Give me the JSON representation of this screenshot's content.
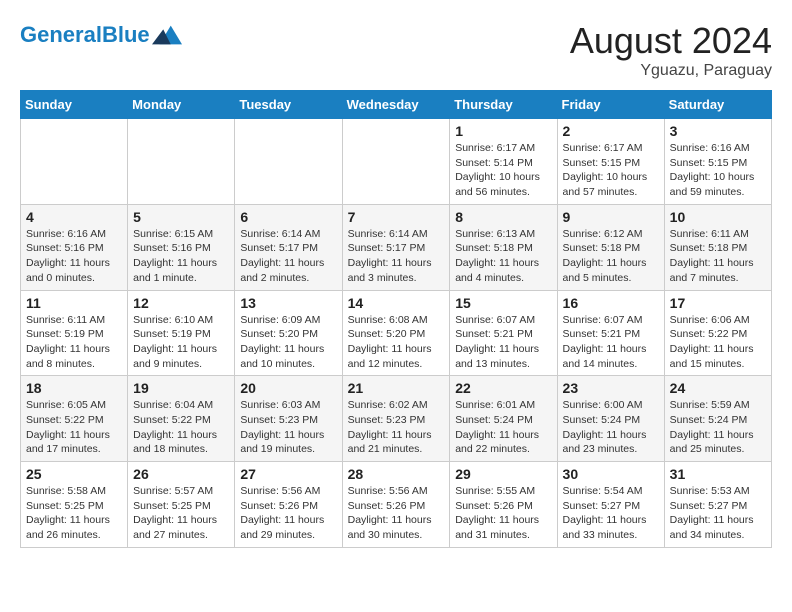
{
  "header": {
    "logo_line1": "General",
    "logo_line2": "Blue",
    "month": "August 2024",
    "location": "Yguazu, Paraguay"
  },
  "days_of_week": [
    "Sunday",
    "Monday",
    "Tuesday",
    "Wednesday",
    "Thursday",
    "Friday",
    "Saturday"
  ],
  "weeks": [
    [
      {
        "num": "",
        "info": ""
      },
      {
        "num": "",
        "info": ""
      },
      {
        "num": "",
        "info": ""
      },
      {
        "num": "",
        "info": ""
      },
      {
        "num": "1",
        "info": "Sunrise: 6:17 AM\nSunset: 5:14 PM\nDaylight: 10 hours and 56 minutes."
      },
      {
        "num": "2",
        "info": "Sunrise: 6:17 AM\nSunset: 5:15 PM\nDaylight: 10 hours and 57 minutes."
      },
      {
        "num": "3",
        "info": "Sunrise: 6:16 AM\nSunset: 5:15 PM\nDaylight: 10 hours and 59 minutes."
      }
    ],
    [
      {
        "num": "4",
        "info": "Sunrise: 6:16 AM\nSunset: 5:16 PM\nDaylight: 11 hours and 0 minutes."
      },
      {
        "num": "5",
        "info": "Sunrise: 6:15 AM\nSunset: 5:16 PM\nDaylight: 11 hours and 1 minute."
      },
      {
        "num": "6",
        "info": "Sunrise: 6:14 AM\nSunset: 5:17 PM\nDaylight: 11 hours and 2 minutes."
      },
      {
        "num": "7",
        "info": "Sunrise: 6:14 AM\nSunset: 5:17 PM\nDaylight: 11 hours and 3 minutes."
      },
      {
        "num": "8",
        "info": "Sunrise: 6:13 AM\nSunset: 5:18 PM\nDaylight: 11 hours and 4 minutes."
      },
      {
        "num": "9",
        "info": "Sunrise: 6:12 AM\nSunset: 5:18 PM\nDaylight: 11 hours and 5 minutes."
      },
      {
        "num": "10",
        "info": "Sunrise: 6:11 AM\nSunset: 5:18 PM\nDaylight: 11 hours and 7 minutes."
      }
    ],
    [
      {
        "num": "11",
        "info": "Sunrise: 6:11 AM\nSunset: 5:19 PM\nDaylight: 11 hours and 8 minutes."
      },
      {
        "num": "12",
        "info": "Sunrise: 6:10 AM\nSunset: 5:19 PM\nDaylight: 11 hours and 9 minutes."
      },
      {
        "num": "13",
        "info": "Sunrise: 6:09 AM\nSunset: 5:20 PM\nDaylight: 11 hours and 10 minutes."
      },
      {
        "num": "14",
        "info": "Sunrise: 6:08 AM\nSunset: 5:20 PM\nDaylight: 11 hours and 12 minutes."
      },
      {
        "num": "15",
        "info": "Sunrise: 6:07 AM\nSunset: 5:21 PM\nDaylight: 11 hours and 13 minutes."
      },
      {
        "num": "16",
        "info": "Sunrise: 6:07 AM\nSunset: 5:21 PM\nDaylight: 11 hours and 14 minutes."
      },
      {
        "num": "17",
        "info": "Sunrise: 6:06 AM\nSunset: 5:22 PM\nDaylight: 11 hours and 15 minutes."
      }
    ],
    [
      {
        "num": "18",
        "info": "Sunrise: 6:05 AM\nSunset: 5:22 PM\nDaylight: 11 hours and 17 minutes."
      },
      {
        "num": "19",
        "info": "Sunrise: 6:04 AM\nSunset: 5:22 PM\nDaylight: 11 hours and 18 minutes."
      },
      {
        "num": "20",
        "info": "Sunrise: 6:03 AM\nSunset: 5:23 PM\nDaylight: 11 hours and 19 minutes."
      },
      {
        "num": "21",
        "info": "Sunrise: 6:02 AM\nSunset: 5:23 PM\nDaylight: 11 hours and 21 minutes."
      },
      {
        "num": "22",
        "info": "Sunrise: 6:01 AM\nSunset: 5:24 PM\nDaylight: 11 hours and 22 minutes."
      },
      {
        "num": "23",
        "info": "Sunrise: 6:00 AM\nSunset: 5:24 PM\nDaylight: 11 hours and 23 minutes."
      },
      {
        "num": "24",
        "info": "Sunrise: 5:59 AM\nSunset: 5:24 PM\nDaylight: 11 hours and 25 minutes."
      }
    ],
    [
      {
        "num": "25",
        "info": "Sunrise: 5:58 AM\nSunset: 5:25 PM\nDaylight: 11 hours and 26 minutes."
      },
      {
        "num": "26",
        "info": "Sunrise: 5:57 AM\nSunset: 5:25 PM\nDaylight: 11 hours and 27 minutes."
      },
      {
        "num": "27",
        "info": "Sunrise: 5:56 AM\nSunset: 5:26 PM\nDaylight: 11 hours and 29 minutes."
      },
      {
        "num": "28",
        "info": "Sunrise: 5:56 AM\nSunset: 5:26 PM\nDaylight: 11 hours and 30 minutes."
      },
      {
        "num": "29",
        "info": "Sunrise: 5:55 AM\nSunset: 5:26 PM\nDaylight: 11 hours and 31 minutes."
      },
      {
        "num": "30",
        "info": "Sunrise: 5:54 AM\nSunset: 5:27 PM\nDaylight: 11 hours and 33 minutes."
      },
      {
        "num": "31",
        "info": "Sunrise: 5:53 AM\nSunset: 5:27 PM\nDaylight: 11 hours and 34 minutes."
      }
    ]
  ]
}
